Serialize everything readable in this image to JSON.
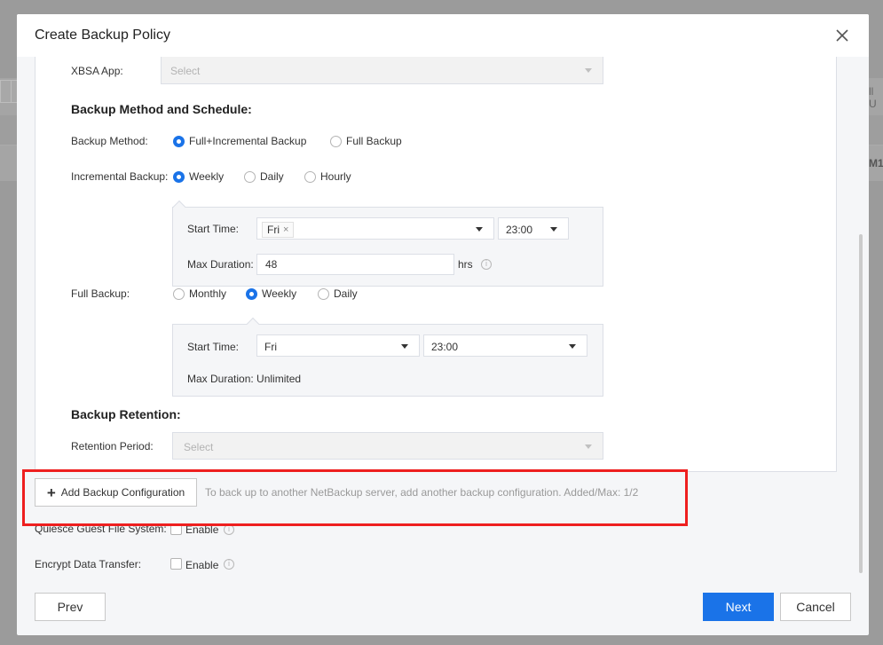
{
  "dialog": {
    "title": "Create Backup Policy",
    "close_icon": "close-icon"
  },
  "background": {
    "partial_label_1": "ll U",
    "partial_label_2": "M1"
  },
  "xbsa": {
    "label": "XBSA App:",
    "placeholder": "Select"
  },
  "method_section": {
    "heading": "Backup Method and Schedule:",
    "method_label": "Backup Method:",
    "method_options": [
      "Full+Incremental Backup",
      "Full Backup"
    ],
    "method_selected": "Full+Incremental Backup"
  },
  "incremental": {
    "label": "Incremental Backup:",
    "options": [
      "Weekly",
      "Daily",
      "Hourly"
    ],
    "selected": "Weekly",
    "start_time_label": "Start Time:",
    "day_tag": "Fri",
    "time": "23:00",
    "max_duration_label": "Max Duration:",
    "max_duration_value": "48",
    "unit": "hrs"
  },
  "full": {
    "label": "Full Backup:",
    "options": [
      "Monthly",
      "Weekly",
      "Daily"
    ],
    "selected": "Weekly",
    "start_time_label": "Start Time:",
    "day": "Fri",
    "time": "23:00",
    "max_duration_text": "Max Duration: Unlimited"
  },
  "retention": {
    "heading": "Backup Retention:",
    "label": "Retention Period:",
    "placeholder": "Select"
  },
  "add_config": {
    "button_label": "Add Backup Configuration",
    "hint": "To back up to another NetBackup server, add another backup configuration. Added/Max: 1/2"
  },
  "quiesce": {
    "label": "Quiesce Guest File System:",
    "checkbox_label": "Enable"
  },
  "encrypt": {
    "label": "Encrypt Data Transfer:",
    "checkbox_label": "Enable"
  },
  "footer": {
    "prev": "Prev",
    "next": "Next",
    "cancel": "Cancel"
  },
  "colors": {
    "primary": "#1a73e8",
    "highlight_border": "#ee1f1f"
  }
}
